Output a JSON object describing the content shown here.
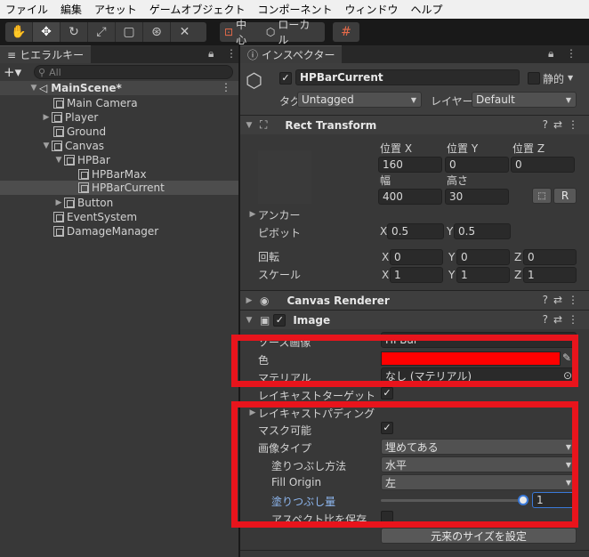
{
  "menu": [
    "ファイル",
    "編集",
    "アセット",
    "ゲームオブジェクト",
    "コンポーネント",
    "ウィンドウ",
    "ヘルプ"
  ],
  "toolbar": {
    "pivot": "中心",
    "space": "ローカル"
  },
  "hierarchy": {
    "tab": "ヒエラルキー",
    "search_placeholder": "All",
    "scene": "MainScene*",
    "items": [
      "Main Camera",
      "Player",
      "Ground",
      "Canvas",
      "HPBar",
      "HPBarMax",
      "HPBarCurrent",
      "Button",
      "EventSystem",
      "DamageManager"
    ]
  },
  "inspector": {
    "tab": "インスペクター",
    "object_name": "HPBarCurrent",
    "static_label": "静的",
    "tag_label": "タグ",
    "tag_value": "Untagged",
    "layer_label": "レイヤー",
    "layer_value": "Default",
    "rect": {
      "title": "Rect Transform",
      "posx_label": "位置 X",
      "posy_label": "位置 Y",
      "posz_label": "位置 Z",
      "posx": "160",
      "posy": "0",
      "posz": "0",
      "width_label": "幅",
      "height_label": "高さ",
      "width": "400",
      "height": "30",
      "r_button": "R",
      "anchor_label": "アンカー",
      "pivot_label": "ピボット",
      "pivot_x": "0.5",
      "pivot_y": "0.5",
      "rotation_label": "回転",
      "rot_x": "0",
      "rot_y": "0",
      "rot_z": "0",
      "scale_label": "スケール",
      "scale_x": "1",
      "scale_y": "1",
      "scale_z": "1",
      "x": "X",
      "y": "Y",
      "z": "Z"
    },
    "canvas_renderer": {
      "title": "Canvas Renderer"
    },
    "image": {
      "title": "Image",
      "source_label": "ソース画像",
      "source_value": "HPBar",
      "color_label": "色",
      "color": "#ff0000",
      "material_label": "マテリアル",
      "material_value": "なし (マテリアル)",
      "raycast_target_label": "レイキャストターゲット",
      "raycast_padding_label": "レイキャストパディング",
      "maskable_label": "マスク可能",
      "image_type_label": "画像タイプ",
      "image_type_value": "埋めてある",
      "fill_method_label": "塗りつぶし方法",
      "fill_method_value": "水平",
      "fill_origin_label": "Fill Origin",
      "fill_origin_value": "左",
      "fill_amount_label": "塗りつぶし量",
      "fill_amount_value": "1",
      "preserve_aspect_label": "アスペクト比を保存",
      "native_size_button": "元来のサイズを設定"
    }
  },
  "colors": {
    "highlight": "#e8141c",
    "accent_blue": "#8eb7f0"
  }
}
